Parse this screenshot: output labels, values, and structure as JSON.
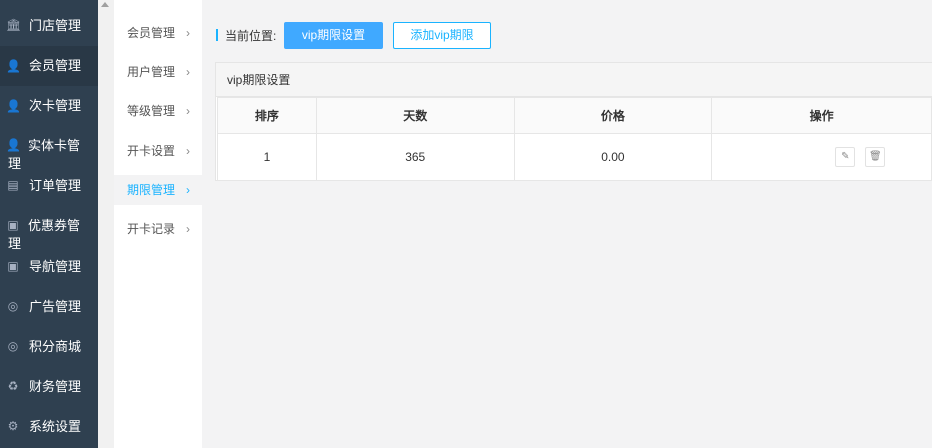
{
  "sidebar": {
    "items": [
      {
        "label": "门店管理",
        "icon": "bank-icon",
        "glyph": "🏛"
      },
      {
        "label": "会员管理",
        "icon": "user-icon",
        "glyph": "👤"
      },
      {
        "label": "次卡管理",
        "icon": "user-icon",
        "glyph": "👤"
      },
      {
        "label": "实体卡管理",
        "icon": "user-icon",
        "glyph": "👤"
      },
      {
        "label": "订单管理",
        "icon": "file-icon",
        "glyph": "▤"
      },
      {
        "label": "优惠券管理",
        "icon": "money-icon",
        "glyph": "▣"
      },
      {
        "label": "导航管理",
        "icon": "money-icon",
        "glyph": "▣"
      },
      {
        "label": "广告管理",
        "icon": "lifebuoy-icon",
        "glyph": "◎"
      },
      {
        "label": "积分商城",
        "icon": "lifebuoy-icon",
        "glyph": "◎"
      },
      {
        "label": "财务管理",
        "icon": "recycle-icon",
        "glyph": "♻"
      },
      {
        "label": "系统设置",
        "icon": "gear-icon",
        "glyph": "⚙"
      }
    ]
  },
  "submenu": {
    "items": [
      {
        "label": "会员管理"
      },
      {
        "label": "用户管理"
      },
      {
        "label": "等级管理"
      },
      {
        "label": "开卡设置"
      },
      {
        "label": "期限管理"
      },
      {
        "label": "开卡记录"
      }
    ],
    "chevron": "›"
  },
  "breadcrumb": {
    "label": "当前位置:",
    "current_button": "vip期限设置",
    "add_button": "添加vip期限"
  },
  "panel": {
    "title": "vip期限设置",
    "columns": [
      "排序",
      "天数",
      "价格",
      "操作"
    ],
    "rows": [
      {
        "order": "1",
        "days": "365",
        "price": "0.00"
      }
    ]
  },
  "colors": {
    "sidebar_bg": "#2f4050",
    "accent": "#1ab3ff",
    "primary_button": "#40a9ff"
  }
}
